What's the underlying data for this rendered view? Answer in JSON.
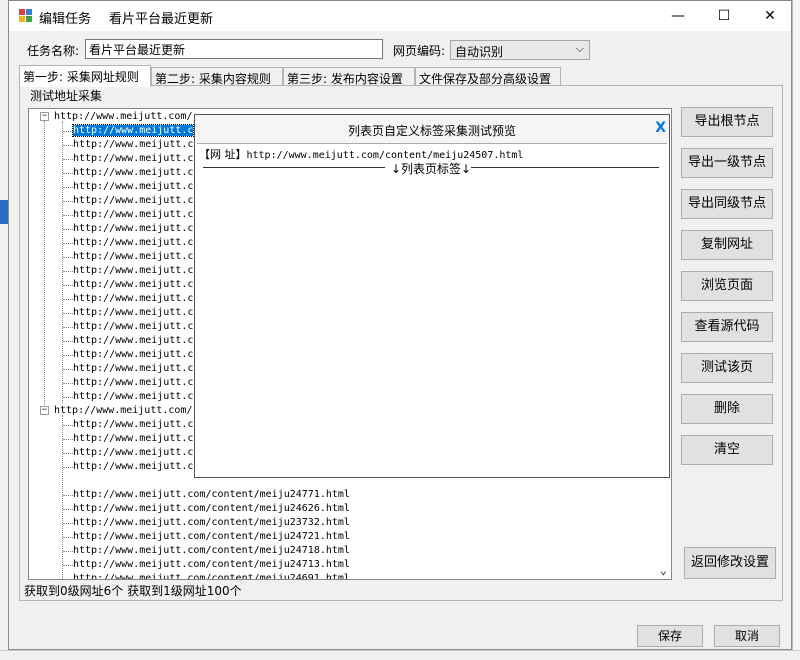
{
  "window": {
    "title": "编辑任务",
    "subtitle": "看片平台最近更新",
    "min_icon": "minimize-icon",
    "max_icon": "maximize-icon",
    "close_icon": "close-icon"
  },
  "form": {
    "task_name_label": "任务名称:",
    "task_name_value": "看片平台最近更新",
    "encoding_label": "网页编码:",
    "encoding_value": "自动识别"
  },
  "tabs": [
    "第一步: 采集网址规则",
    "第二步: 采集内容规则",
    "第三步: 发布内容设置",
    "文件保存及部分高级设置"
  ],
  "group": {
    "title": "测试地址采集"
  },
  "tree": {
    "root1": "http://www.meijutt.com/",
    "root2": "http://www.meijutt.com/",
    "child_prefix": "http://www.meijutt.c",
    "full_rows": [
      "http://www.meijutt.com/content/meiju24771.html",
      "http://www.meijutt.com/content/meiju24626.html",
      "http://www.meijutt.com/content/meiju23732.html",
      "http://www.meijutt.com/content/meiju24721.html",
      "http://www.meijutt.com/content/meiju24718.html",
      "http://www.meijutt.com/content/meiju24713.html"
    ],
    "partial_bottom": "http://www.meijutt.com/content/meiju24691.html"
  },
  "buttons": {
    "export_root": "导出根节点",
    "export_level1": "导出一级节点",
    "export_sibling": "导出同级节点",
    "copy_url": "复制网址",
    "browse": "浏览页面",
    "view_source": "查看源代码",
    "test_page": "测试该页",
    "delete": "删除",
    "clear": "清空",
    "back": "返回修改设置"
  },
  "popup": {
    "title": "列表页自定义标签采集测试预览",
    "close": "X",
    "url_label": "【网 址】",
    "url_value": "http://www.meijutt.com/content/meiju24507.html",
    "divider_text": "↓列表页标签↓"
  },
  "status": "获取到0级网址6个 获取到1级网址100个",
  "footer": {
    "save": "保存",
    "cancel": "取消"
  }
}
